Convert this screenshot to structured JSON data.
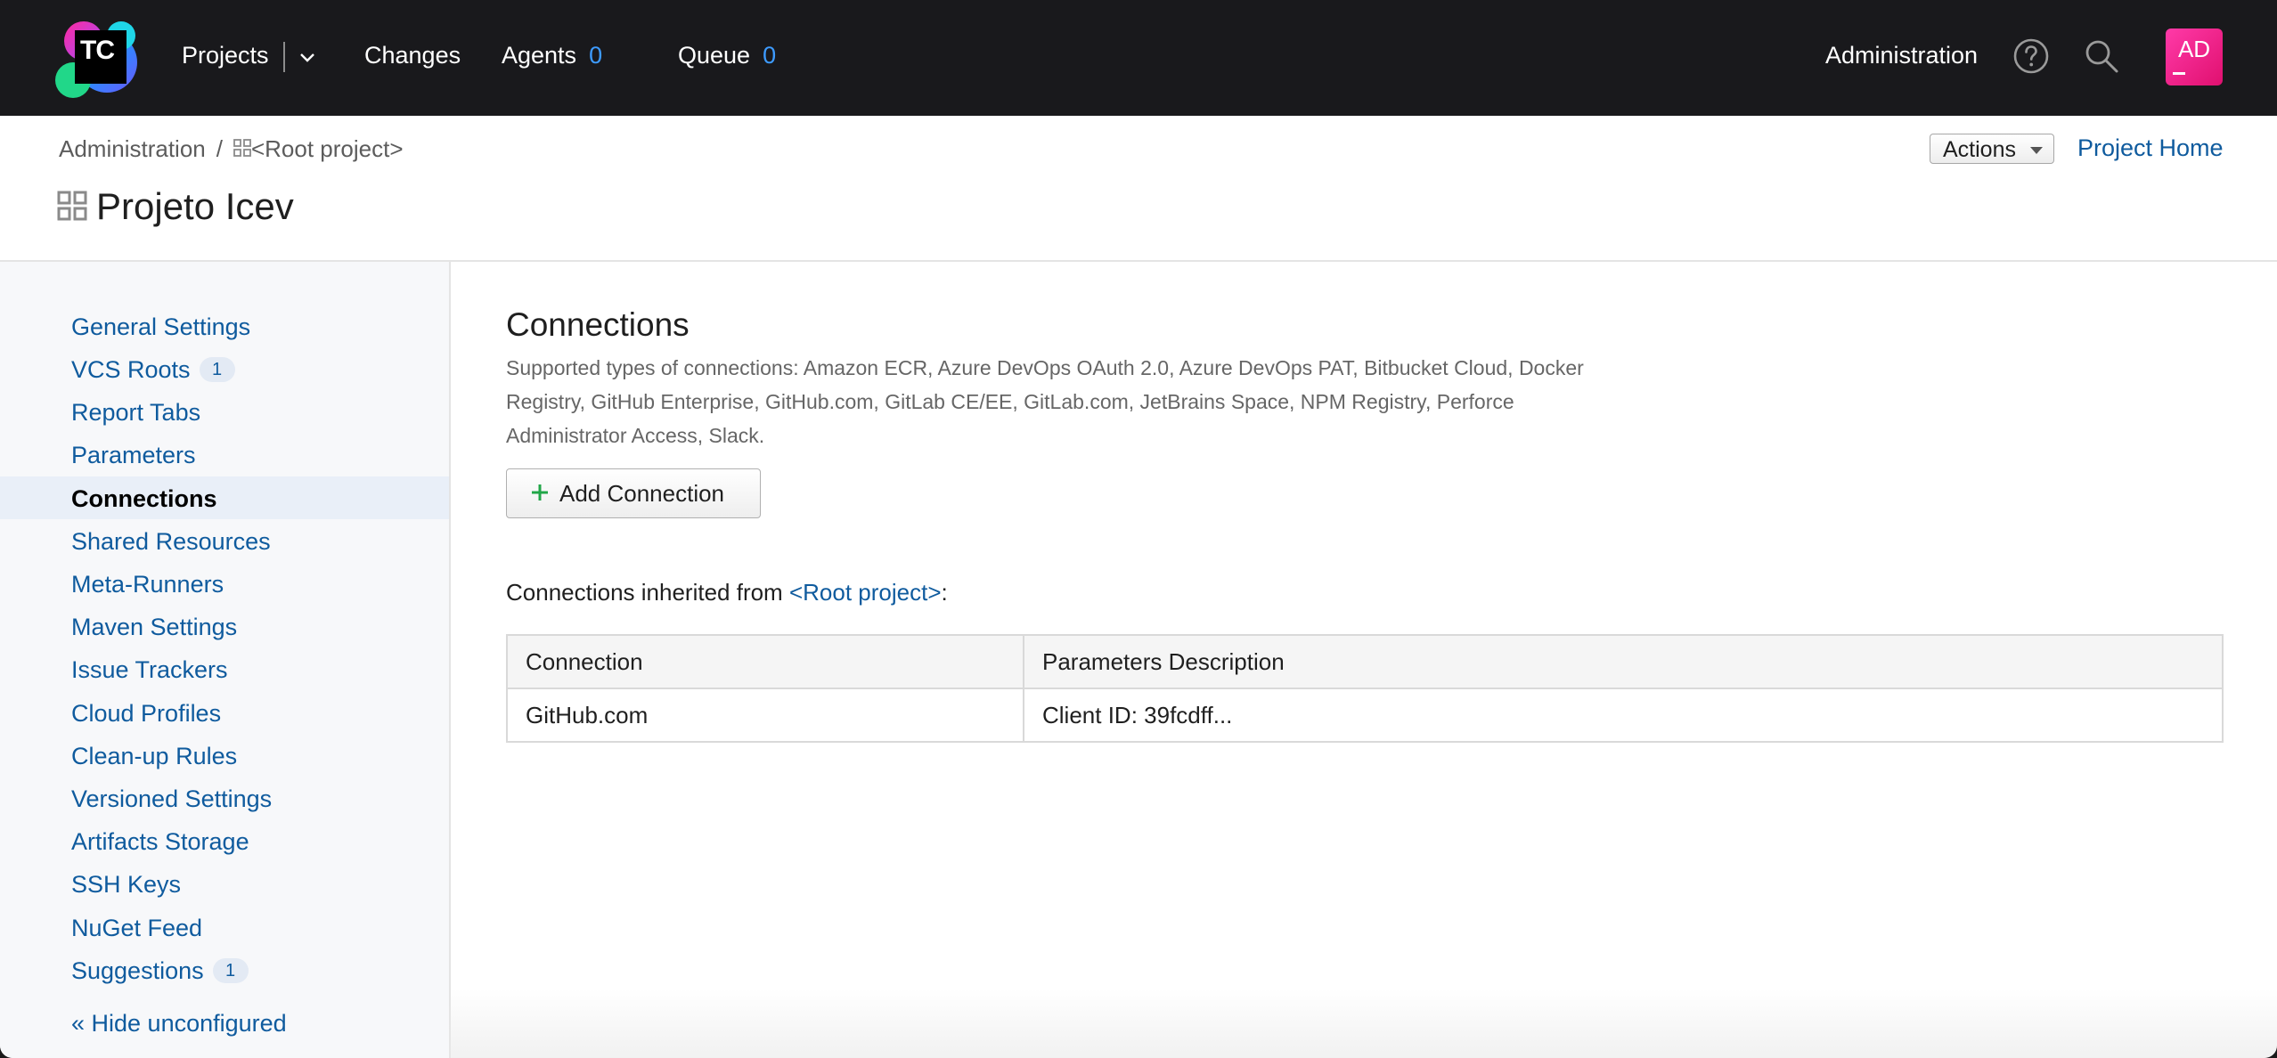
{
  "header": {
    "logo_text": "TC",
    "nav": {
      "projects": "Projects",
      "changes": "Changes",
      "agents": "Agents",
      "agents_count": "0",
      "queue": "Queue",
      "queue_count": "0",
      "administration": "Administration"
    },
    "icons": [
      "help-icon",
      "search-icon"
    ],
    "avatar_initials": "AD",
    "avatar_color": "#e0106f"
  },
  "breadcrumb": {
    "root": "Administration",
    "separator": "/",
    "project": "<Root project>"
  },
  "page": {
    "title": "Projeto Icev",
    "actions_label": "Actions",
    "project_home": "Project Home"
  },
  "sidebar": {
    "items": [
      {
        "label": "General Settings"
      },
      {
        "label": "VCS Roots",
        "badge": "1"
      },
      {
        "label": "Report Tabs"
      },
      {
        "label": "Parameters"
      },
      {
        "label": "Connections",
        "active": true
      },
      {
        "label": "Shared Resources"
      },
      {
        "label": "Meta-Runners"
      },
      {
        "label": "Maven Settings"
      },
      {
        "label": "Issue Trackers"
      },
      {
        "label": "Cloud Profiles"
      },
      {
        "label": "Clean-up Rules"
      },
      {
        "label": "Versioned Settings"
      },
      {
        "label": "Artifacts Storage"
      },
      {
        "label": "SSH Keys"
      },
      {
        "label": "NuGet Feed"
      },
      {
        "label": "Suggestions",
        "badge": "1"
      }
    ],
    "hide_unconfigured": "« Hide unconfigured"
  },
  "main": {
    "title": "Connections",
    "description": "Supported types of connections: Amazon ECR, Azure DevOps OAuth 2.0, Azure DevOps PAT, Bitbucket Cloud, Docker Registry, GitHub Enterprise, GitHub.com, GitLab CE/EE, GitLab.com, JetBrains Space, NPM Registry, Perforce Administrator Access, Slack.",
    "add_button": "Add Connection",
    "inherited_prefix": "Connections inherited from ",
    "inherited_link": "<Root project>",
    "inherited_suffix": ":",
    "table": {
      "headers": [
        "Connection",
        "Parameters Description"
      ],
      "rows": [
        [
          "GitHub.com",
          "Client ID: 39fcdff..."
        ]
      ]
    }
  },
  "colors": {
    "link": "#0f5b9e",
    "header_bg": "#19191c",
    "count_blue": "#3d9bff",
    "active_bg": "#e9eff8"
  }
}
